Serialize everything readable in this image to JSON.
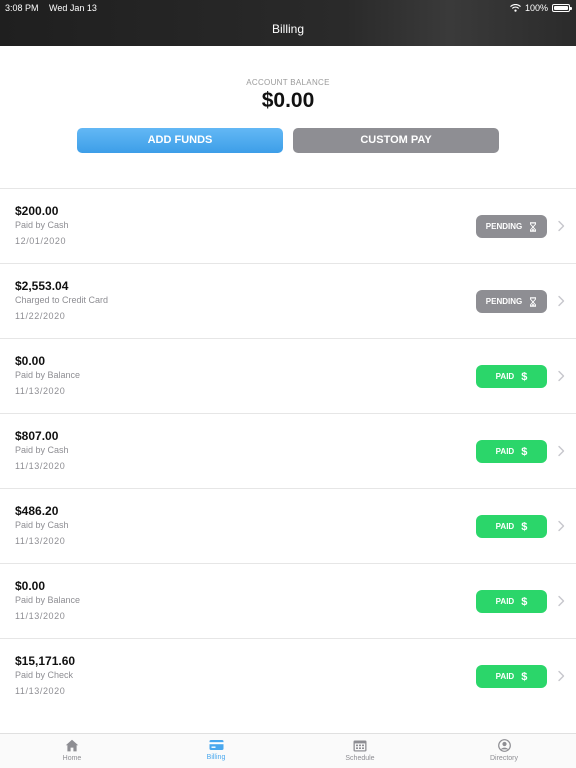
{
  "status_bar": {
    "time": "3:08 PM",
    "date": "Wed Jan 13",
    "battery": "100%"
  },
  "header": {
    "title": "Billing"
  },
  "balance": {
    "label": "ACCOUNT BALANCE",
    "amount": "$0.00"
  },
  "actions": {
    "add_funds": "ADD FUNDS",
    "custom_pay": "CUSTOM PAY"
  },
  "transactions": [
    {
      "amount": "$200.00",
      "method": "Paid by Cash",
      "date": "12/01/2020",
      "status": "PENDING",
      "status_icon": "hourglass-icon"
    },
    {
      "amount": "$2,553.04",
      "method": "Charged to Credit Card",
      "date": "11/22/2020",
      "status": "PENDING",
      "status_icon": "hourglass-icon"
    },
    {
      "amount": "$0.00",
      "method": "Paid by Balance",
      "date": "11/13/2020",
      "status": "PAID",
      "status_icon": "dollar-icon"
    },
    {
      "amount": "$807.00",
      "method": "Paid by Cash",
      "date": "11/13/2020",
      "status": "PAID",
      "status_icon": "dollar-icon"
    },
    {
      "amount": "$486.20",
      "method": "Paid by Cash",
      "date": "11/13/2020",
      "status": "PAID",
      "status_icon": "dollar-icon"
    },
    {
      "amount": "$0.00",
      "method": "Paid by Balance",
      "date": "11/13/2020",
      "status": "PAID",
      "status_icon": "dollar-icon"
    },
    {
      "amount": "$15,171.60",
      "method": "Paid by Check",
      "date": "11/13/2020",
      "status": "PAID",
      "status_icon": "dollar-icon"
    }
  ],
  "tabs": [
    {
      "label": "Home",
      "icon": "home-icon",
      "active": false
    },
    {
      "label": "Billing",
      "icon": "credit-card-icon",
      "active": true
    },
    {
      "label": "Schedule",
      "icon": "calendar-icon",
      "active": false
    },
    {
      "label": "Directory",
      "icon": "person-circle-icon",
      "active": false
    }
  ],
  "colors": {
    "accent": "#4aa8ee",
    "paid": "#2bd66a",
    "pending": "#8e8e93",
    "header": "#2a2a2a"
  }
}
